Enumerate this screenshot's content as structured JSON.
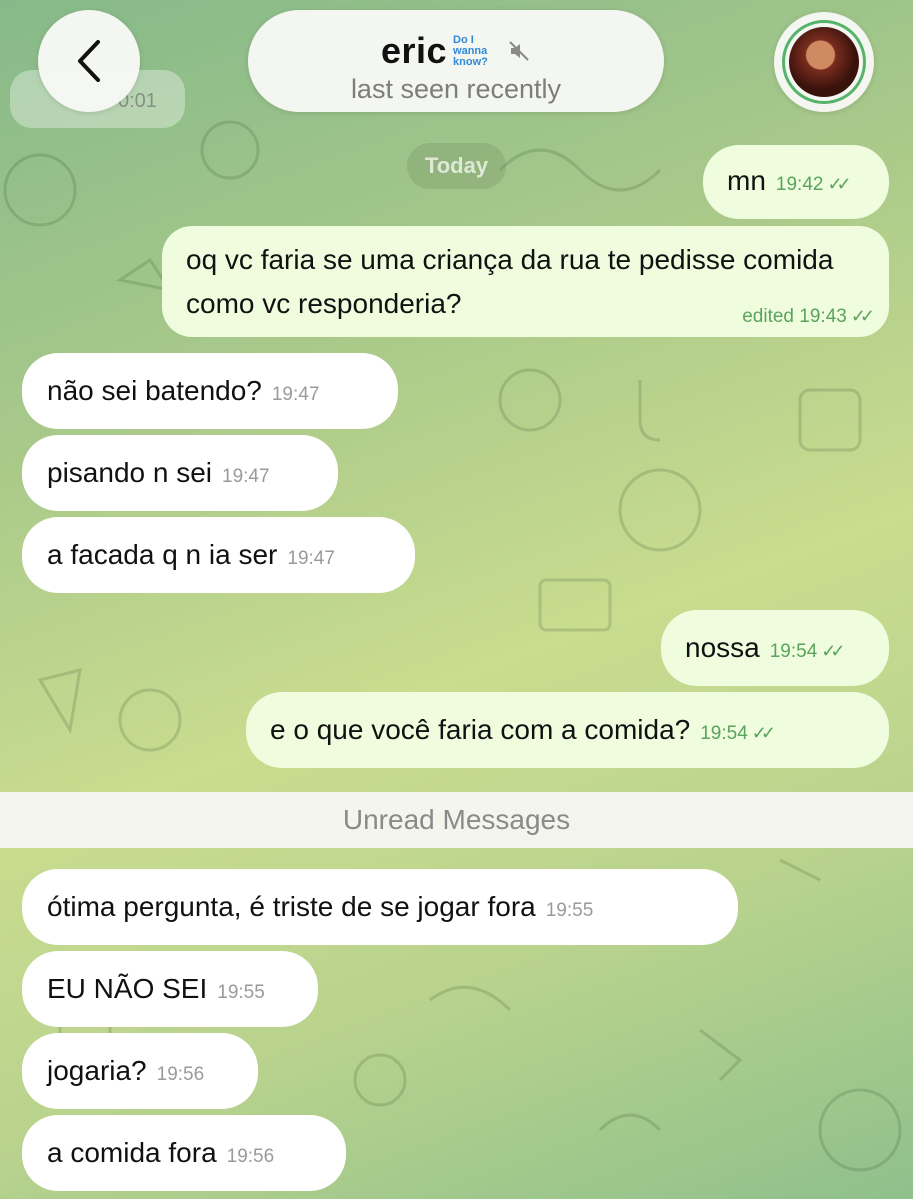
{
  "header": {
    "contact_name": "eric",
    "emoji_status": "Do I wanna know?",
    "last_seen": "last seen recently",
    "back_icon": "chevron-left-icon",
    "mute_icon": "muted-speaker-icon"
  },
  "partial_prev_time": "0:01",
  "date_label": "Today",
  "messages": [
    {
      "id": "m1",
      "direction": "out",
      "text": "mn",
      "time": "19:42",
      "edited": ""
    },
    {
      "id": "m2",
      "direction": "out",
      "text": "oq vc faria se uma criança da rua te  pedisse comida como vc responderia?",
      "time": "19:43",
      "edited": "edited"
    },
    {
      "id": "m3",
      "direction": "in",
      "text": "não sei batendo?",
      "time": "19:47"
    },
    {
      "id": "m4",
      "direction": "in",
      "text": "pisando n sei",
      "time": "19:47"
    },
    {
      "id": "m5",
      "direction": "in",
      "text": "a facada q n ia ser",
      "time": "19:47"
    },
    {
      "id": "m6",
      "direction": "out",
      "text": "nossa",
      "time": "19:54",
      "edited": ""
    },
    {
      "id": "m7",
      "direction": "out",
      "text": "e o que você faria com a comida?",
      "time": "19:54",
      "edited": ""
    },
    {
      "id": "m8",
      "direction": "in",
      "text": "ótima pergunta, é triste de se jogar fora",
      "time": "19:55"
    },
    {
      "id": "m9",
      "direction": "in",
      "text": "EU NÃO SEI",
      "time": "19:55"
    },
    {
      "id": "m10",
      "direction": "in",
      "text": "jogaria?",
      "time": "19:56"
    },
    {
      "id": "m11",
      "direction": "in",
      "text": "a comida fora",
      "time": "19:56"
    }
  ],
  "unread_label": "Unread Messages",
  "colors": {
    "incoming_bubble": "#ffffff",
    "outgoing_bubble": "#effdde",
    "read_ticks": "#5aa35c"
  }
}
